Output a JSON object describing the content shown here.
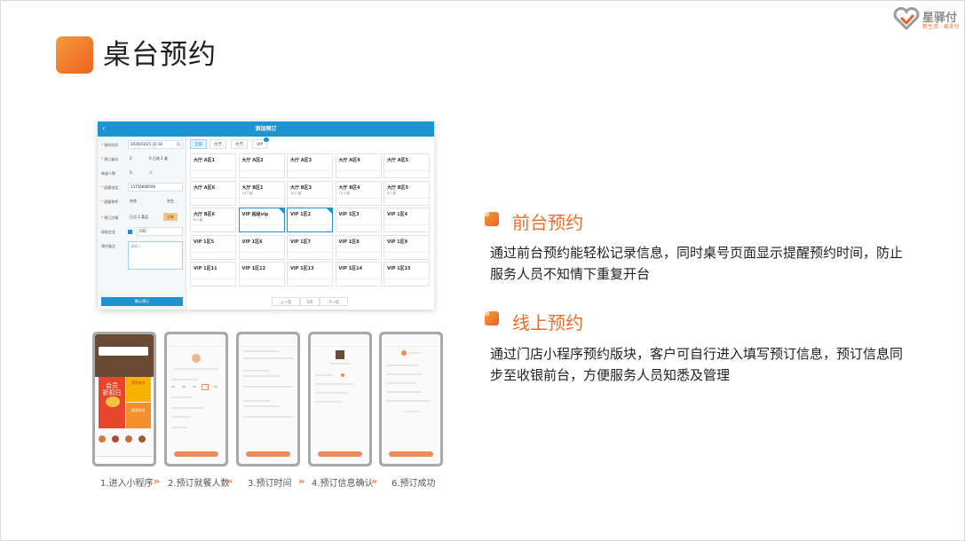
{
  "slide": {
    "title": "桌台预约",
    "logo_name": "星驿付",
    "logo_slogan": "新生活 · 易支付"
  },
  "desktop": {
    "header_title": "添加预订",
    "back_glyph": "‹",
    "form": {
      "time_label": "预约时间",
      "time_value": "2020/03/25 23:18",
      "time_suffix": "日",
      "tables_label": "预订桌台",
      "tables_value": "2",
      "tables_extra": "0   已选 2 桌",
      "diners_label": "每桌人数",
      "diners_value": "0",
      "diners_unit": "人",
      "phone_label": "顾客电话",
      "phone_value": "15759688596",
      "name_label": "顾客称呼",
      "name_value": "杰克",
      "name_suffix": "先生",
      "dish_label": "预订点餐",
      "dish_value": "已点 1 菜品",
      "dish_tag": "点餐",
      "deposit_label": "收取定金",
      "deposit_value": "500",
      "note_label": "预约备注",
      "note_placeholder": "请输入",
      "confirm_label": "确认预订"
    },
    "tabs": [
      {
        "label": "全部",
        "active": true
      },
      {
        "label": "大厅",
        "active": false
      },
      {
        "label": "大厅",
        "active": false
      },
      {
        "label": "VIP",
        "active": false
      }
    ],
    "tables": [
      {
        "name": "大厅 A区1",
        "info": "",
        "reserved": false
      },
      {
        "name": "大厅 A区2",
        "info": "",
        "reserved": false
      },
      {
        "name": "大厅 A区3",
        "info": "",
        "reserved": false
      },
      {
        "name": "大厅 A区4",
        "info": "",
        "reserved": false
      },
      {
        "name": "大厅 A区5",
        "info": "",
        "reserved": false
      },
      {
        "name": "大厅 A区6",
        "info": "",
        "reserved": false
      },
      {
        "name": "大厅 B区1",
        "info": "10人桌",
        "reserved": false
      },
      {
        "name": "大厅 B区3",
        "info": "10人桌",
        "reserved": false
      },
      {
        "name": "大厅 B区4",
        "info": "10人桌",
        "reserved": false
      },
      {
        "name": "大厅 B区5",
        "info": "8人桌",
        "reserved": false
      },
      {
        "name": "大厅 B区6",
        "info": "8人桌",
        "reserved": false
      },
      {
        "name": "VIP 超级vip",
        "info": "",
        "reserved": true
      },
      {
        "name": "VIP 1区2",
        "info": "",
        "reserved": true
      },
      {
        "name": "VIP 1区3",
        "info": "",
        "reserved": false
      },
      {
        "name": "VIP 1区4",
        "info": "",
        "reserved": false
      },
      {
        "name": "VIP 1区5",
        "info": "",
        "reserved": false
      },
      {
        "name": "VIP 1区6",
        "info": "",
        "reserved": false
      },
      {
        "name": "VIP 1区7",
        "info": "",
        "reserved": false
      },
      {
        "name": "VIP 1区8",
        "info": "",
        "reserved": false
      },
      {
        "name": "VIP 1区9",
        "info": "",
        "reserved": false
      },
      {
        "name": "VIP 1区11",
        "info": "",
        "reserved": false
      },
      {
        "name": "VIP 1区12",
        "info": "",
        "reserved": false
      },
      {
        "name": "VIP 1区13",
        "info": "",
        "reserved": false
      },
      {
        "name": "VIP 1区14",
        "info": "",
        "reserved": false
      },
      {
        "name": "VIP 1区15",
        "info": "",
        "reserved": false
      }
    ],
    "pager": {
      "prev": "上一页",
      "page": "1/5",
      "next": "下一页"
    }
  },
  "sections": [
    {
      "title": "前台预约",
      "text": "通过前台预约能轻松记录信息，同时桌号页面显示提醒预约时间，防止服务人员不知情下重复开台"
    },
    {
      "title": "线上预约",
      "text": "通过门店小程序预约版块，客户可自行进入填写预订信息，预订信息同步至收银前台，方便服务人员知悉及管理"
    }
  ],
  "phones": [
    {
      "step": "1.进入小程序",
      "promo_top": "会员\n折扣日",
      "promo_right": "签到有礼",
      "promo_bottom": "邀请有礼"
    },
    {
      "step": "2.预订就餐人数"
    },
    {
      "step": "3.预订时间"
    },
    {
      "step": "4.预订信息确认"
    },
    {
      "step": "6.预订成功"
    }
  ],
  "colors": {
    "accent": "#ec6223",
    "brand_blue": "#1d94d0",
    "section_title": "#e8702c"
  }
}
